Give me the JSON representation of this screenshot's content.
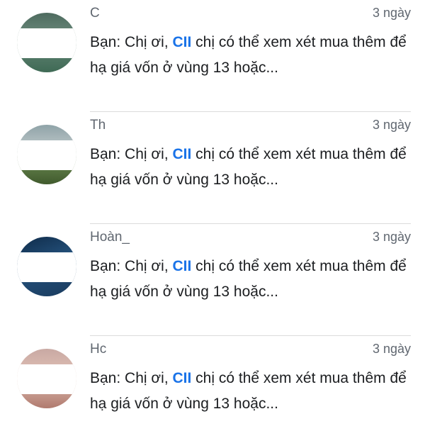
{
  "messages": [
    {
      "name": "C",
      "time": "3 ngày",
      "prefix": "Bạn: Chị ơi, ",
      "tag": "CII",
      "text": " chị có thể xem xét mua thêm để hạ giá vốn ở vùng 13 hoặc...",
      "avatar_color": "#5a7d6c"
    },
    {
      "name": "Th",
      "time": "3 ngày",
      "prefix": "Bạn: Chị ơi, ",
      "tag": "CII",
      "text": " chị có thể xem xét mua thêm để hạ giá vốn ở vùng 13 hoặc...",
      "avatar_color": "#6b8a55"
    },
    {
      "name": "Hoàn_",
      "time": "3 ngày",
      "prefix": "Bạn: Chị ơi, ",
      "tag": "CII",
      "text": " chị có thể xem xét mua thêm để hạ giá vốn ở vùng 13 hoặc...",
      "avatar_color": "#1f4469"
    },
    {
      "name": "Hc",
      "time": "3 ngày",
      "prefix": "Bạn: Chị ơi, ",
      "tag": "CII",
      "text": " chị có thể xem xét mua thêm để hạ giá vốn ở vùng 13 hoặc...",
      "avatar_color": "#c9a29a"
    }
  ],
  "colors": {
    "tag": "#1a73e8",
    "meta": "#606770",
    "text": "#1c1e21",
    "divider": "#dcdcdc"
  }
}
